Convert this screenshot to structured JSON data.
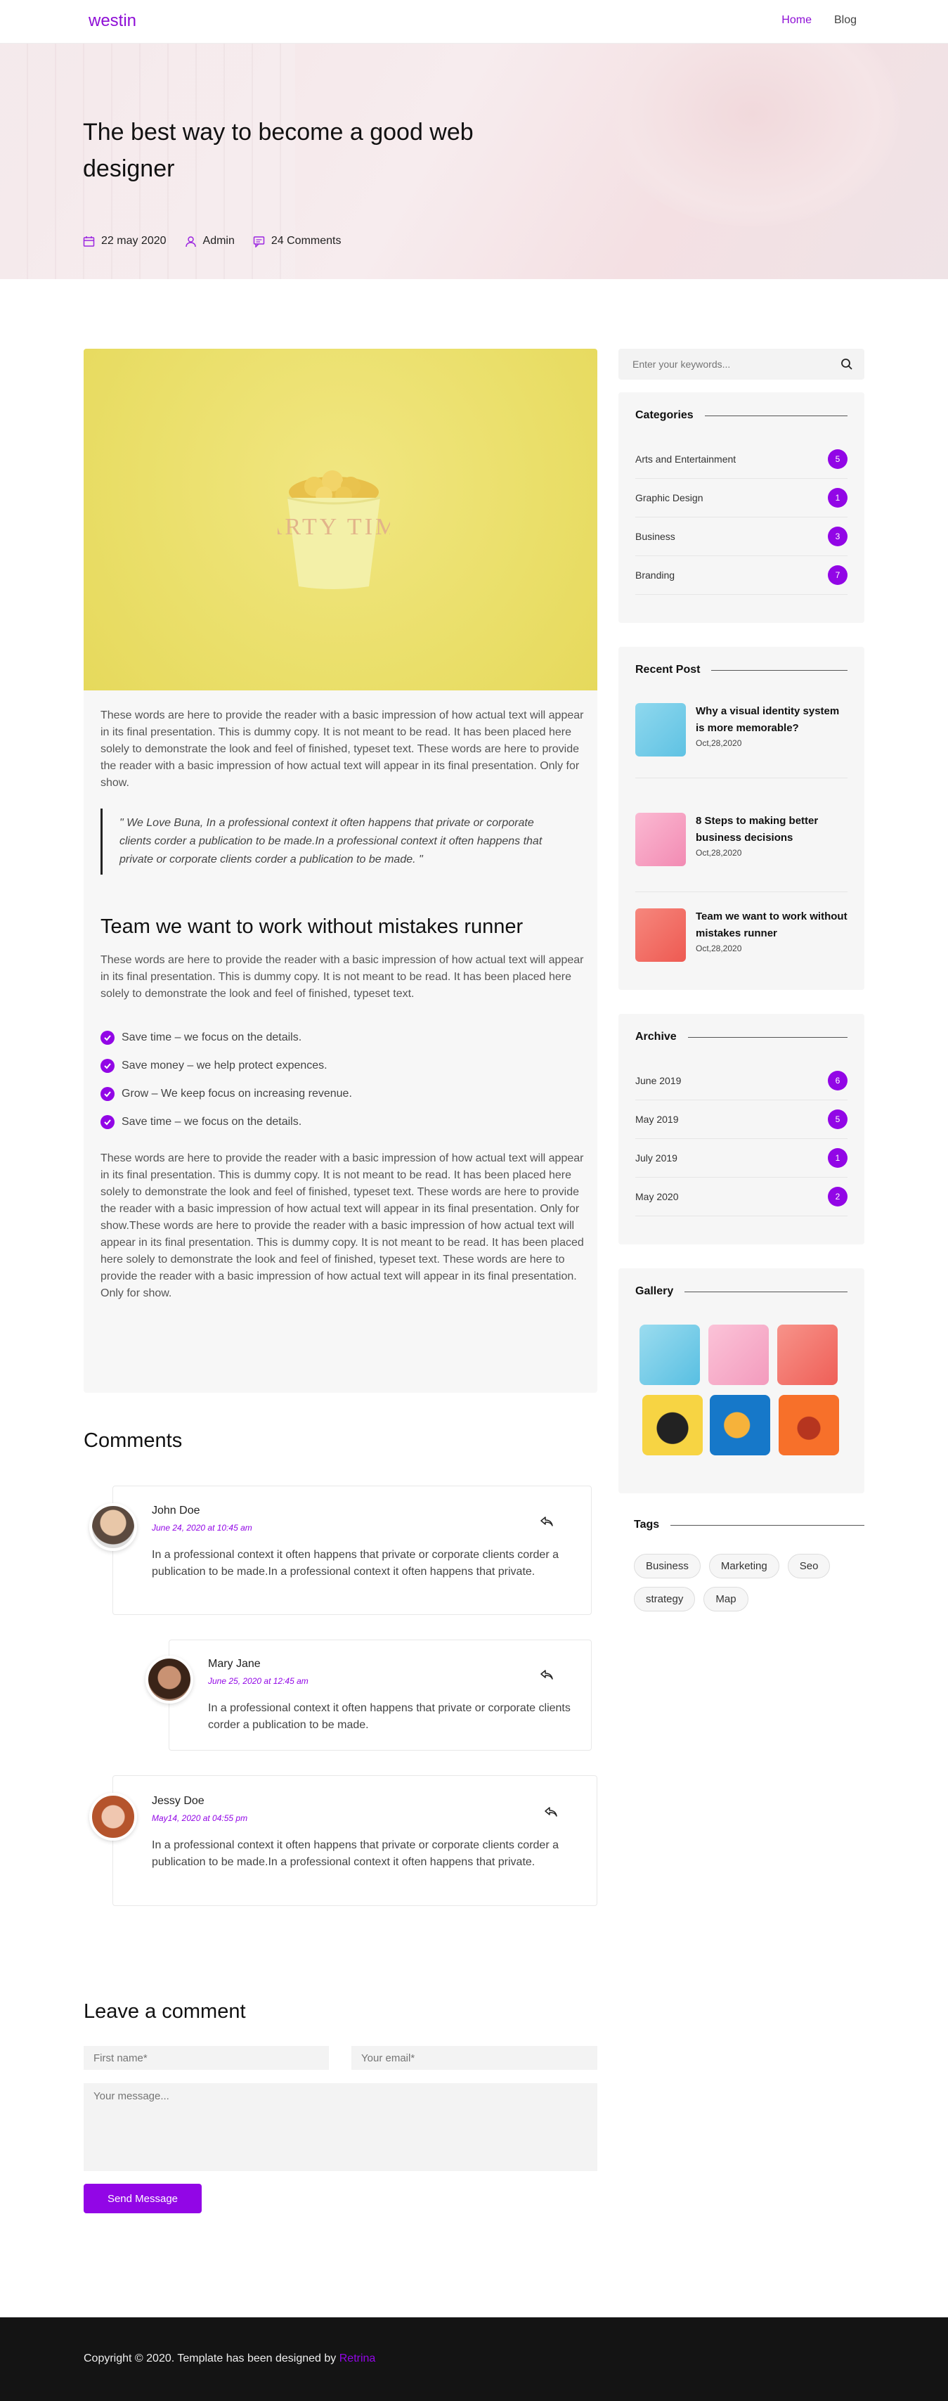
{
  "nav": {
    "logo": "westin",
    "links": [
      {
        "label": "Home"
      },
      {
        "label": "Blog"
      }
    ]
  },
  "hero": {
    "title": "The best way to become a good web designer",
    "date": "22 may 2020",
    "author": "Admin",
    "comments": "24 Comments"
  },
  "article": {
    "intro": "These words are here to provide the reader with a basic impression of how actual text will appear in its final presentation. This is dummy copy. It is not meant to be read. It has been placed here solely to demonstrate the look and feel of finished, typeset text. These words are here to provide the reader with a basic impression of how actual text will appear in its final presentation. Only for show.",
    "quote": "\" We Love Buna, In a professional context it often happens that private or corporate clients corder a publication to be made.In a professional context it often happens that private or corporate clients corder a publication to be made. \"",
    "heading": "Team we want to work without mistakes runner",
    "para2": "These words are here to provide the reader with a basic impression of how actual text will appear in its final presentation. This is dummy copy. It is not meant to be read. It has been placed here solely to demonstrate the look and feel of finished, typeset text.",
    "checks": [
      "Save time – we focus on the details.",
      "Save money – we help protect expences.",
      "Grow – We keep focus on increasing revenue.",
      "Save time – we focus on the details."
    ],
    "para3": "These words are here to provide the reader with a basic impression of how actual text will appear in its final presentation. This is dummy copy. It is not meant to be read. It has been placed here solely to demonstrate the look and feel of finished, typeset text. These words are here to provide the reader with a basic impression of how actual text will appear in its final presentation. Only for show.These words are here to provide the reader with a basic impression of how actual text will appear in its final presentation. This is dummy copy. It is not meant to be read. It has been placed here solely to demonstrate the look and feel of finished, typeset text. These words are here to provide the reader with a basic impression of how actual text will appear in its final presentation. Only for show.",
    "image_text": "PARTY TIME"
  },
  "sidebar": {
    "search_placeholder": "Enter your keywords...",
    "categories": {
      "title": "Categories",
      "items": [
        {
          "label": "Arts and Entertainment",
          "count": "5"
        },
        {
          "label": "Graphic Design",
          "count": "1"
        },
        {
          "label": "Business",
          "count": "3"
        },
        {
          "label": "Branding",
          "count": "7"
        }
      ]
    },
    "recent": {
      "title": "Recent Post",
      "items": [
        {
          "title": "Why a visual identity system is more memorable?",
          "date": "Oct,28,2020",
          "color": "#7dd0e9"
        },
        {
          "title": "8 Steps to making better business decisions",
          "date": "Oct,28,2020",
          "color": "#f7a6c5"
        },
        {
          "title": "Team we want to work without mistakes runner",
          "date": "Oct,28,2020",
          "color": "#f26a62"
        }
      ]
    },
    "archive": {
      "title": "Archive",
      "items": [
        {
          "label": "June 2019",
          "count": "6"
        },
        {
          "label": "May 2019",
          "count": "5"
        },
        {
          "label": "July 2019",
          "count": "1"
        },
        {
          "label": "May 2020",
          "count": "2"
        }
      ]
    },
    "gallery": {
      "title": "Gallery",
      "colors": [
        "#7dd0e9",
        "#f7a6c5",
        "#f26a62",
        "#f7d443",
        "#1678c9",
        "#f7702a"
      ]
    },
    "tags": {
      "title": "Tags",
      "items": [
        "Business",
        "Marketing",
        "Seo",
        "strategy",
        "Map"
      ]
    }
  },
  "comments": {
    "title": "Comments",
    "items": [
      {
        "name": "John Doe",
        "date": "June 24, 2020 at 10:45 am",
        "text": "In a professional context it often happens that private or corporate clients corder a publication to be made.In a professional context it often happens that private."
      },
      {
        "name": "Mary Jane",
        "date": "June 25, 2020 at 12:45 am",
        "text": "In a professional context it often happens that private or corporate clients corder a publication to be made."
      },
      {
        "name": "Jessy Doe",
        "date": "May14, 2020 at 04:55 pm",
        "text": "In a professional context it often happens that private or corporate clients corder a publication to be made.In a professional context it often happens that private."
      }
    ]
  },
  "form": {
    "title": "Leave a comment",
    "first_name": "First name*",
    "email": "Your email*",
    "message": "Your message...",
    "send": "Send Message"
  },
  "footer": {
    "text": "Copyright © 2020. Template has been designed by ",
    "brand": "Retrina"
  },
  "colors": {
    "accent": "#9206e6",
    "footer_bg": "#141414"
  }
}
